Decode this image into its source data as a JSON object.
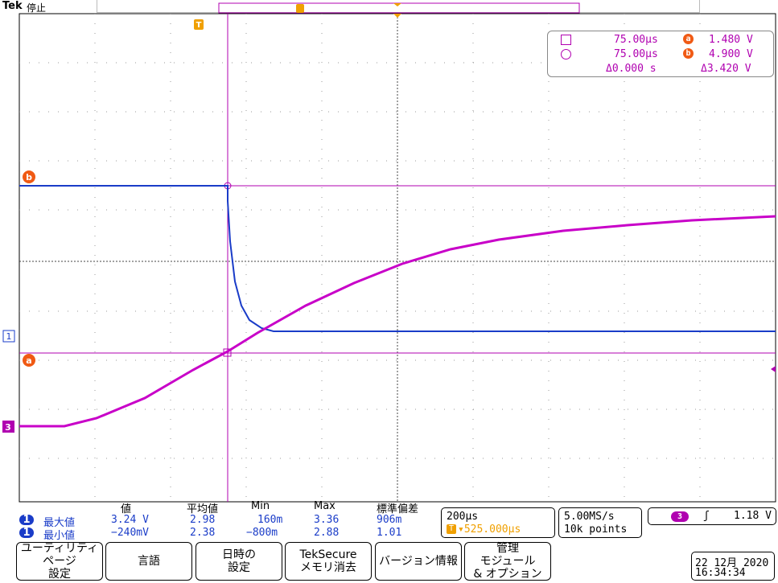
{
  "header": {
    "brand": "Tek",
    "run_state": "停止"
  },
  "markers": {
    "trigger_top": "T",
    "cursor_a": "a",
    "cursor_b": "b",
    "ch1": "1",
    "ch3": "3"
  },
  "cursor_readout": {
    "row1": {
      "time": "75.00µs",
      "label": "a",
      "value": "1.480 V"
    },
    "row2": {
      "time": "75.00µs",
      "label": "b",
      "value": "4.900 V"
    },
    "row3": {
      "delta_time": "Δ0.000 s",
      "delta_value": "Δ3.420 V"
    }
  },
  "measurements": {
    "headers": [
      "値",
      "平均値",
      "Min",
      "Max",
      "標準偏差"
    ],
    "rows": [
      {
        "ch": "1",
        "name": "最大値",
        "values": [
          "3.24 V",
          "2.98",
          "160m",
          "3.36",
          "906m"
        ]
      },
      {
        "ch": "1",
        "name": "最小値",
        "values": [
          "−240mV",
          "2.38",
          "−800m",
          "2.88",
          "1.01"
        ]
      }
    ]
  },
  "timebase": {
    "scale": "200µs",
    "position_prefix": "T",
    "position": "▾525.000µs"
  },
  "acquisition": {
    "rate": "5.00MS/s",
    "points": "10k points"
  },
  "trigger": {
    "channel": "3",
    "slope": "ʃ",
    "level": "1.18 V"
  },
  "softkeys": [
    {
      "line1": "ユーティリティ",
      "line2": "ページ",
      "line3": "設定"
    },
    {
      "line1": "言語",
      "line2": "",
      "line3": ""
    },
    {
      "line1": "日時の",
      "line2": "設定",
      "line3": ""
    },
    {
      "line1": "TekSecure",
      "line2": "メモリ消去",
      "line3": ""
    },
    {
      "line1": "バージョン情報",
      "line2": "",
      "line3": ""
    },
    {
      "line1": "管理",
      "line2": "モジュール",
      "line3": "& オプション"
    }
  ],
  "datetime": {
    "date": "22 12月 2020",
    "time": "16:34:34"
  },
  "colors": {
    "ch1": "#1a3cc8",
    "ch3": "#c800c8",
    "cursor": "#b000b0",
    "marker": "#f05a14",
    "trigger": "#f0a000"
  }
}
